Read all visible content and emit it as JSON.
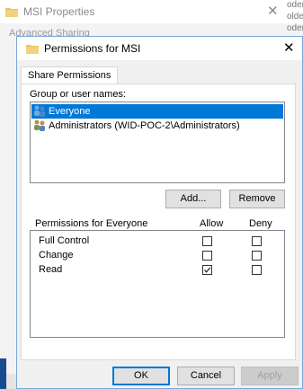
{
  "background_window": {
    "title": "MSI Properties",
    "tab_label": "Advanced Sharing",
    "side_texts": [
      "oder",
      "older",
      "oder",
      "older"
    ]
  },
  "dialog": {
    "title": "Permissions for MSI",
    "tab": "Share Permissions",
    "group_label": "Group or user names:",
    "users": [
      {
        "name": "Everyone",
        "selected": true,
        "icon": "users-group-icon"
      },
      {
        "name": "Administrators (WID-POC-2\\Administrators)",
        "selected": false,
        "icon": "admin-group-icon"
      }
    ],
    "add_button": "Add...",
    "remove_button": "Remove",
    "permissions_label": "Permissions for Everyone",
    "allow_header": "Allow",
    "deny_header": "Deny",
    "permissions": [
      {
        "name": "Full Control",
        "allow": false,
        "deny": false
      },
      {
        "name": "Change",
        "allow": false,
        "deny": false
      },
      {
        "name": "Read",
        "allow": true,
        "deny": false
      }
    ],
    "ok_button": "OK",
    "cancel_button": "Cancel",
    "apply_button": "Apply"
  },
  "colors": {
    "selection": "#0078d7",
    "dialog_border": "#7ca6d6",
    "folder": "#e8c25a"
  }
}
